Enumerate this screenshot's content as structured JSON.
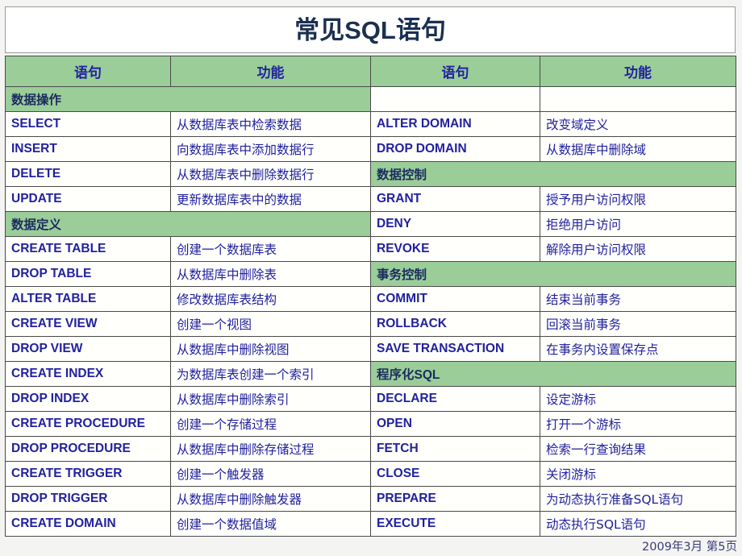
{
  "slide": {
    "title": "常见SQL语句",
    "footer": "2009年3月 第5页",
    "colors": {
      "band_green": "#9bcd99",
      "text_blue": "#21219e",
      "title_navy": "#1b3050",
      "page_background": "#f4f4f2"
    }
  },
  "table": {
    "headers": [
      "语句",
      "功能",
      "语句",
      "功能"
    ],
    "left": [
      {
        "type": "section",
        "label": "数据操作"
      },
      {
        "type": "row",
        "statement": "SELECT",
        "function": "从数据库表中检索数据"
      },
      {
        "type": "row",
        "statement": "INSERT",
        "function": "向数据库表中添加数据行"
      },
      {
        "type": "row",
        "statement": "DELETE",
        "function": "从数据库表中删除数据行"
      },
      {
        "type": "row",
        "statement": "UPDATE",
        "function": "更新数据库表中的数据"
      },
      {
        "type": "section",
        "label": "数据定义"
      },
      {
        "type": "row",
        "statement": "CREATE TABLE",
        "function": "创建一个数据库表"
      },
      {
        "type": "row",
        "statement": "DROP TABLE",
        "function": "从数据库中删除表"
      },
      {
        "type": "row",
        "statement": "ALTER TABLE",
        "function": "修改数据库表结构"
      },
      {
        "type": "row",
        "statement": "CREATE VIEW",
        "function": "创建一个视图"
      },
      {
        "type": "row",
        "statement": "DROP VIEW",
        "function": "从数据库中删除视图"
      },
      {
        "type": "row",
        "statement": "CREATE INDEX",
        "function": "为数据库表创建一个索引"
      },
      {
        "type": "row",
        "statement": "DROP INDEX",
        "function": "从数据库中删除索引"
      },
      {
        "type": "row",
        "statement": "CREATE PROCEDURE",
        "function": "创建一个存储过程"
      },
      {
        "type": "row",
        "statement": "DROP PROCEDURE",
        "function": "从数据库中删除存储过程"
      },
      {
        "type": "row",
        "statement": "CREATE TRIGGER",
        "function": "创建一个触发器"
      },
      {
        "type": "row",
        "statement": "DROP TRIGGER",
        "function": "从数据库中删除触发器"
      },
      {
        "type": "row",
        "statement": "CREATE DOMAIN",
        "function": "创建一个数据值域"
      }
    ],
    "right": [
      {
        "type": "blank",
        "statement": "",
        "function": ""
      },
      {
        "type": "row",
        "statement": "ALTER DOMAIN",
        "function": "改变域定义"
      },
      {
        "type": "row",
        "statement": "DROP DOMAIN",
        "function": "从数据库中删除域"
      },
      {
        "type": "section",
        "label": "数据控制"
      },
      {
        "type": "row",
        "statement": "GRANT",
        "function": "授予用户访问权限"
      },
      {
        "type": "row",
        "statement": "DENY",
        "function": "拒绝用户访问"
      },
      {
        "type": "row",
        "statement": "REVOKE",
        "function": "解除用户访问权限"
      },
      {
        "type": "section",
        "label": "事务控制"
      },
      {
        "type": "row",
        "statement": "COMMIT",
        "function": "结束当前事务"
      },
      {
        "type": "row",
        "statement": "ROLLBACK",
        "function": "回滚当前事务"
      },
      {
        "type": "row",
        "statement": "SAVE TRANSACTION",
        "function": "在事务内设置保存点"
      },
      {
        "type": "section",
        "label": "程序化SQL"
      },
      {
        "type": "row",
        "statement": "DECLARE",
        "function": "设定游标"
      },
      {
        "type": "row",
        "statement": "OPEN",
        "function": "打开一个游标"
      },
      {
        "type": "row",
        "statement": "FETCH",
        "function": "检索一行查询结果"
      },
      {
        "type": "row",
        "statement": "CLOSE",
        "function": "关闭游标"
      },
      {
        "type": "row",
        "statement": "PREPARE",
        "function": "为动态执行准备SQL语句"
      },
      {
        "type": "row",
        "statement": "EXECUTE",
        "function": "动态执行SQL语句"
      }
    ]
  }
}
